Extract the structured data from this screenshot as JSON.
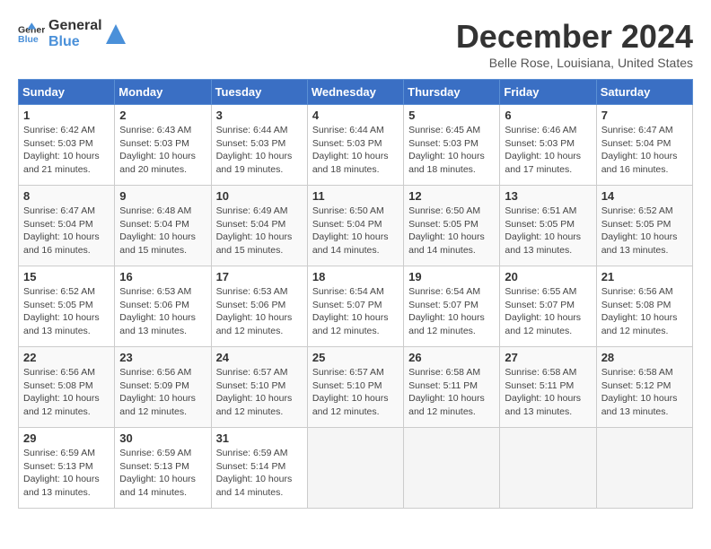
{
  "logo": {
    "text_general": "General",
    "text_blue": "Blue"
  },
  "title": "December 2024",
  "subtitle": "Belle Rose, Louisiana, United States",
  "headers": [
    "Sunday",
    "Monday",
    "Tuesday",
    "Wednesday",
    "Thursday",
    "Friday",
    "Saturday"
  ],
  "weeks": [
    [
      {
        "day": "1",
        "content": "Sunrise: 6:42 AM\nSunset: 5:03 PM\nDaylight: 10 hours and 21 minutes."
      },
      {
        "day": "2",
        "content": "Sunrise: 6:43 AM\nSunset: 5:03 PM\nDaylight: 10 hours and 20 minutes."
      },
      {
        "day": "3",
        "content": "Sunrise: 6:44 AM\nSunset: 5:03 PM\nDaylight: 10 hours and 19 minutes."
      },
      {
        "day": "4",
        "content": "Sunrise: 6:44 AM\nSunset: 5:03 PM\nDaylight: 10 hours and 18 minutes."
      },
      {
        "day": "5",
        "content": "Sunrise: 6:45 AM\nSunset: 5:03 PM\nDaylight: 10 hours and 18 minutes."
      },
      {
        "day": "6",
        "content": "Sunrise: 6:46 AM\nSunset: 5:03 PM\nDaylight: 10 hours and 17 minutes."
      },
      {
        "day": "7",
        "content": "Sunrise: 6:47 AM\nSunset: 5:04 PM\nDaylight: 10 hours and 16 minutes."
      }
    ],
    [
      {
        "day": "8",
        "content": "Sunrise: 6:47 AM\nSunset: 5:04 PM\nDaylight: 10 hours and 16 minutes."
      },
      {
        "day": "9",
        "content": "Sunrise: 6:48 AM\nSunset: 5:04 PM\nDaylight: 10 hours and 15 minutes."
      },
      {
        "day": "10",
        "content": "Sunrise: 6:49 AM\nSunset: 5:04 PM\nDaylight: 10 hours and 15 minutes."
      },
      {
        "day": "11",
        "content": "Sunrise: 6:50 AM\nSunset: 5:04 PM\nDaylight: 10 hours and 14 minutes."
      },
      {
        "day": "12",
        "content": "Sunrise: 6:50 AM\nSunset: 5:05 PM\nDaylight: 10 hours and 14 minutes."
      },
      {
        "day": "13",
        "content": "Sunrise: 6:51 AM\nSunset: 5:05 PM\nDaylight: 10 hours and 13 minutes."
      },
      {
        "day": "14",
        "content": "Sunrise: 6:52 AM\nSunset: 5:05 PM\nDaylight: 10 hours and 13 minutes."
      }
    ],
    [
      {
        "day": "15",
        "content": "Sunrise: 6:52 AM\nSunset: 5:05 PM\nDaylight: 10 hours and 13 minutes."
      },
      {
        "day": "16",
        "content": "Sunrise: 6:53 AM\nSunset: 5:06 PM\nDaylight: 10 hours and 13 minutes."
      },
      {
        "day": "17",
        "content": "Sunrise: 6:53 AM\nSunset: 5:06 PM\nDaylight: 10 hours and 12 minutes."
      },
      {
        "day": "18",
        "content": "Sunrise: 6:54 AM\nSunset: 5:07 PM\nDaylight: 10 hours and 12 minutes."
      },
      {
        "day": "19",
        "content": "Sunrise: 6:54 AM\nSunset: 5:07 PM\nDaylight: 10 hours and 12 minutes."
      },
      {
        "day": "20",
        "content": "Sunrise: 6:55 AM\nSunset: 5:07 PM\nDaylight: 10 hours and 12 minutes."
      },
      {
        "day": "21",
        "content": "Sunrise: 6:56 AM\nSunset: 5:08 PM\nDaylight: 10 hours and 12 minutes."
      }
    ],
    [
      {
        "day": "22",
        "content": "Sunrise: 6:56 AM\nSunset: 5:08 PM\nDaylight: 10 hours and 12 minutes."
      },
      {
        "day": "23",
        "content": "Sunrise: 6:56 AM\nSunset: 5:09 PM\nDaylight: 10 hours and 12 minutes."
      },
      {
        "day": "24",
        "content": "Sunrise: 6:57 AM\nSunset: 5:10 PM\nDaylight: 10 hours and 12 minutes."
      },
      {
        "day": "25",
        "content": "Sunrise: 6:57 AM\nSunset: 5:10 PM\nDaylight: 10 hours and 12 minutes."
      },
      {
        "day": "26",
        "content": "Sunrise: 6:58 AM\nSunset: 5:11 PM\nDaylight: 10 hours and 12 minutes."
      },
      {
        "day": "27",
        "content": "Sunrise: 6:58 AM\nSunset: 5:11 PM\nDaylight: 10 hours and 13 minutes."
      },
      {
        "day": "28",
        "content": "Sunrise: 6:58 AM\nSunset: 5:12 PM\nDaylight: 10 hours and 13 minutes."
      }
    ],
    [
      {
        "day": "29",
        "content": "Sunrise: 6:59 AM\nSunset: 5:13 PM\nDaylight: 10 hours and 13 minutes."
      },
      {
        "day": "30",
        "content": "Sunrise: 6:59 AM\nSunset: 5:13 PM\nDaylight: 10 hours and 14 minutes."
      },
      {
        "day": "31",
        "content": "Sunrise: 6:59 AM\nSunset: 5:14 PM\nDaylight: 10 hours and 14 minutes."
      },
      {
        "day": "",
        "content": ""
      },
      {
        "day": "",
        "content": ""
      },
      {
        "day": "",
        "content": ""
      },
      {
        "day": "",
        "content": ""
      }
    ]
  ]
}
